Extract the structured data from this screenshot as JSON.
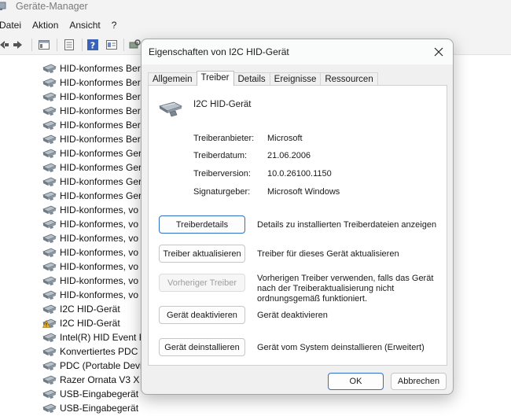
{
  "app": {
    "title": "Geräte-Manager",
    "menu": [
      "Datei",
      "Aktion",
      "Ansicht",
      "?"
    ]
  },
  "toolbar": {
    "icons": [
      "back-arrow-icon",
      "forward-arrow-icon",
      "properties-icon",
      "show-hidden-icon",
      "help-icon",
      "view-icon",
      "scan-hardware-icon"
    ]
  },
  "devices": [
    {
      "label": "HID-konformes Ber",
      "icon": "hid-device-icon"
    },
    {
      "label": "HID-konformes Ber",
      "icon": "hid-device-icon"
    },
    {
      "label": "HID-konformes Ber",
      "icon": "hid-device-icon"
    },
    {
      "label": "HID-konformes Ber",
      "icon": "hid-device-icon"
    },
    {
      "label": "HID-konformes Ber",
      "icon": "hid-device-icon"
    },
    {
      "label": "HID-konformes Ber",
      "icon": "hid-device-icon"
    },
    {
      "label": "HID-konformes Ger",
      "icon": "hid-device-icon"
    },
    {
      "label": "HID-konformes Ger",
      "icon": "hid-device-icon"
    },
    {
      "label": "HID-konformes Ger",
      "icon": "hid-device-icon"
    },
    {
      "label": "HID-konformes Ger",
      "icon": "hid-device-icon"
    },
    {
      "label": "HID-konformes, vo",
      "icon": "hid-device-icon"
    },
    {
      "label": "HID-konformes, vo",
      "icon": "hid-device-icon"
    },
    {
      "label": "HID-konformes, vo",
      "icon": "hid-device-icon"
    },
    {
      "label": "HID-konformes, vo",
      "icon": "hid-device-icon"
    },
    {
      "label": "HID-konformes, vo",
      "icon": "hid-device-icon"
    },
    {
      "label": "HID-konformes, vo",
      "icon": "hid-device-icon"
    },
    {
      "label": "HID-konformes, vo",
      "icon": "hid-device-icon"
    },
    {
      "label": "I2C HID-Gerät",
      "icon": "hid-device-icon"
    },
    {
      "label": "I2C HID-Gerät",
      "icon": "warning-device-icon"
    },
    {
      "label": "Intel(R) HID Event F",
      "icon": "hid-device-icon"
    },
    {
      "label": "Konvertiertes PDC (",
      "icon": "hid-device-icon"
    },
    {
      "label": "PDC (Portable Devic",
      "icon": "hid-device-icon"
    },
    {
      "label": "Razer Ornata V3 X",
      "icon": "hid-device-icon"
    },
    {
      "label": "USB-Eingabegerät",
      "icon": "hid-device-icon"
    },
    {
      "label": "USB-Eingabegerät",
      "icon": "hid-device-icon"
    }
  ],
  "dialog": {
    "title": "Eigenschaften von I2C HID-Gerät",
    "tabs": [
      "Allgemein",
      "Treiber",
      "Details",
      "Ereignisse",
      "Ressourcen"
    ],
    "active_tab": "Treiber",
    "device_name": "I2C HID-Gerät",
    "properties": {
      "provider": {
        "label": "Treiberanbieter:",
        "value": "Microsoft"
      },
      "date": {
        "label": "Treiberdatum:",
        "value": "21.06.2006"
      },
      "version": {
        "label": "Treiberversion:",
        "value": "10.0.26100.1150"
      },
      "signer": {
        "label": "Signaturgeber:",
        "value": "Microsoft Windows"
      }
    },
    "actions": {
      "details": {
        "label": "Treiberdetails",
        "desc": "Details zu installierten Treiberdateien anzeigen"
      },
      "update": {
        "label": "Treiber aktualisieren",
        "desc": "Treiber für dieses Gerät aktualisieren"
      },
      "rollback": {
        "label": "Vorheriger Treiber",
        "desc": "Vorherigen Treiber verwenden, falls das Gerät nach der Treiberaktualisierung nicht ordnungsgemäß funktioniert."
      },
      "disable": {
        "label": "Gerät deaktivieren",
        "desc": "Gerät deaktivieren"
      },
      "uninstall": {
        "label": "Gerät deinstallieren",
        "desc": "Gerät vom System deinstallieren (Erweitert)"
      }
    },
    "ok_label": "OK",
    "cancel_label": "Abbrechen"
  },
  "colors": {
    "accent": "#2f6fc4",
    "warning": "#f2b01e",
    "dialog_bg": "#f0f0f0"
  }
}
